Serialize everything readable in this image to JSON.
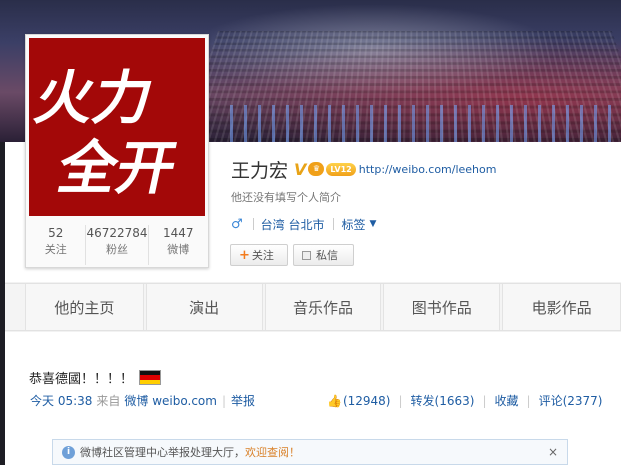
{
  "profile": {
    "name": "王力宏",
    "url": "http://weibo.com/leehom",
    "bio": "他还没有填写个人简介",
    "gender_icon": "♂",
    "location": "台湾 台北市",
    "tags_label": "标签",
    "level_badge": "LV12",
    "vip_badge": "V"
  },
  "avatar": {
    "line1": "火力",
    "line2": "全开",
    "bg_color": "#a30808"
  },
  "stats": [
    {
      "num": "52",
      "label": "关注"
    },
    {
      "num": "46722784",
      "label": "粉丝"
    },
    {
      "num": "1447",
      "label": "微博"
    }
  ],
  "buttons": {
    "follow": "关注",
    "message": "私信"
  },
  "tabs": [
    "他的主页",
    "演出",
    "音乐作品",
    "图书作品",
    "电影作品"
  ],
  "post": {
    "text": "恭喜德國！！！！",
    "time": "今天 05:38",
    "from_label": "来自",
    "source": "微博 weibo.com",
    "report": "举报",
    "likes": "(12948)",
    "forward": "转发(1663)",
    "favorite": "收藏",
    "comment": "评论(2377)"
  },
  "notice": {
    "text": "微博社区管理中心举报处理大厅，",
    "link": "欢迎查阅！",
    "close": "×"
  }
}
